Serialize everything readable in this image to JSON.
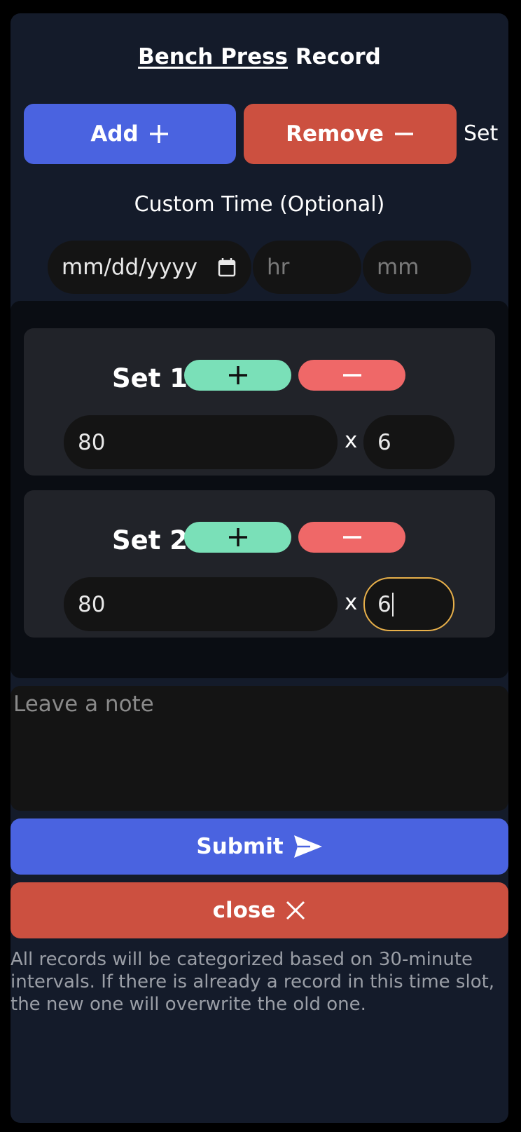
{
  "header": {
    "exercise_name": "Bench Press",
    "title_suffix": "Record"
  },
  "set_controls": {
    "add_label": "Add",
    "remove_label": "Remove",
    "set_label": "Set"
  },
  "custom_time": {
    "label": "Custom Time (Optional)",
    "date_placeholder": "mm/dd/yyyy",
    "hour_placeholder": "hr",
    "minute_placeholder": "mm"
  },
  "sets": [
    {
      "label": "Set 1",
      "weight": "80",
      "times": "x",
      "reps": "6"
    },
    {
      "label": "Set 2",
      "weight": "80",
      "times": "x",
      "reps": "6"
    }
  ],
  "note": {
    "placeholder": "Leave a note"
  },
  "actions": {
    "submit_label": "Submit",
    "close_label": "close"
  },
  "footnote": "All records will be categorized based on 30-minute intervals. If there is already a record in this time slot, the new one will overwrite the old one.",
  "colors": {
    "primary": "#4a63e0",
    "danger": "#cc5040",
    "mini_plus": "#7ae0b8",
    "mini_minus": "#ef6868",
    "focus_ring": "#e8b04a"
  },
  "icons": {
    "add": "plus-icon",
    "remove": "minus-icon",
    "date": "calendar-icon",
    "submit": "send-icon",
    "close": "close-icon"
  }
}
